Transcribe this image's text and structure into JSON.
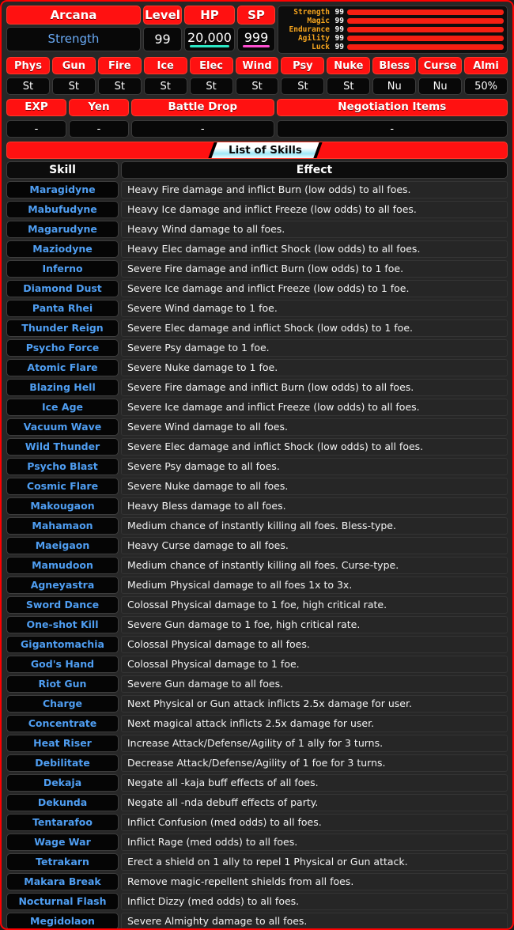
{
  "overview": {
    "arcana_label": "Arcana",
    "arcana_value": "Strength",
    "level_label": "Level",
    "level_value": "99",
    "hp_label": "HP",
    "hp_value": "20,000",
    "sp_label": "SP",
    "sp_value": "999"
  },
  "stats": {
    "max": 99,
    "rows": [
      {
        "name": "Strength",
        "value": "99"
      },
      {
        "name": "Magic",
        "value": "99"
      },
      {
        "name": "Endurance",
        "value": "99"
      },
      {
        "name": "Agility",
        "value": "99"
      },
      {
        "name": "Luck",
        "value": "99"
      }
    ]
  },
  "affinities": [
    {
      "element": "Phys",
      "value": "St"
    },
    {
      "element": "Gun",
      "value": "St"
    },
    {
      "element": "Fire",
      "value": "St"
    },
    {
      "element": "Ice",
      "value": "St"
    },
    {
      "element": "Elec",
      "value": "St"
    },
    {
      "element": "Wind",
      "value": "St"
    },
    {
      "element": "Psy",
      "value": "St"
    },
    {
      "element": "Nuke",
      "value": "St"
    },
    {
      "element": "Bless",
      "value": "Nu"
    },
    {
      "element": "Curse",
      "value": "Nu"
    },
    {
      "element": "Almi",
      "value": "50%"
    }
  ],
  "drops": [
    {
      "label": "EXP",
      "value": "-"
    },
    {
      "label": "Yen",
      "value": "-"
    },
    {
      "label": "Battle Drop",
      "value": "-"
    },
    {
      "label": "Negotiation Items",
      "value": "-"
    }
  ],
  "skills_section": {
    "banner_title": "List of Skills",
    "col_skill": "Skill",
    "col_effect": "Effect"
  },
  "skills": [
    {
      "name": "Maragidyne",
      "effect": "Heavy Fire damage and inflict Burn (low odds) to all foes."
    },
    {
      "name": "Mabufudyne",
      "effect": "Heavy Ice damage and inflict Freeze (low odds) to all foes."
    },
    {
      "name": "Magarudyne",
      "effect": "Heavy Wind damage to all foes."
    },
    {
      "name": "Maziodyne",
      "effect": "Heavy Elec damage and inflict Shock (low odds) to all foes."
    },
    {
      "name": "Inferno",
      "effect": "Severe Fire damage and inflict Burn (low odds) to 1 foe."
    },
    {
      "name": "Diamond Dust",
      "effect": "Severe Ice damage and inflict Freeze (low odds) to 1 foe."
    },
    {
      "name": "Panta Rhei",
      "effect": "Severe Wind damage to 1 foe."
    },
    {
      "name": "Thunder Reign",
      "effect": "Severe Elec damage and inflict Shock (low odds) to 1 foe."
    },
    {
      "name": "Psycho Force",
      "effect": "Severe Psy damage to 1 foe."
    },
    {
      "name": "Atomic Flare",
      "effect": "Severe Nuke damage to 1 foe."
    },
    {
      "name": "Blazing Hell",
      "effect": "Severe Fire damage and inflict Burn (low odds) to all foes."
    },
    {
      "name": "Ice Age",
      "effect": "Severe Ice damage and inflict Freeze (low odds) to all foes."
    },
    {
      "name": "Vacuum Wave",
      "effect": "Severe Wind damage to all foes."
    },
    {
      "name": "Wild Thunder",
      "effect": "Severe Elec damage and inflict Shock (low odds) to all foes."
    },
    {
      "name": "Psycho Blast",
      "effect": "Severe Psy damage to all foes."
    },
    {
      "name": "Cosmic Flare",
      "effect": "Severe Nuke damage to all foes."
    },
    {
      "name": "Makougaon",
      "effect": "Heavy Bless damage to all foes."
    },
    {
      "name": "Mahamaon",
      "effect": "Medium chance of instantly killing all foes. Bless-type."
    },
    {
      "name": "Maeigaon",
      "effect": "Heavy Curse damage to all foes."
    },
    {
      "name": "Mamudoon",
      "effect": "Medium chance of instantly killing all foes. Curse-type."
    },
    {
      "name": "Agneyastra",
      "effect": "Medium Physical damage to all foes 1x to 3x."
    },
    {
      "name": "Sword Dance",
      "effect": "Colossal Physical damage to 1 foe, high critical rate."
    },
    {
      "name": "One-shot Kill",
      "effect": "Severe Gun damage to 1 foe, high critical rate."
    },
    {
      "name": "Gigantomachia",
      "effect": "Colossal Physical damage to all foes."
    },
    {
      "name": "God's Hand",
      "effect": "Colossal Physical damage to 1 foe."
    },
    {
      "name": "Riot Gun",
      "effect": "Severe Gun damage to all foes."
    },
    {
      "name": "Charge",
      "effect": "Next Physical or Gun attack inflicts 2.5x damage for user."
    },
    {
      "name": "Concentrate",
      "effect": "Next magical attack inflicts 2.5x damage for user."
    },
    {
      "name": "Heat Riser",
      "effect": "Increase Attack/Defense/Agility of 1 ally for 3 turns."
    },
    {
      "name": "Debilitate",
      "effect": "Decrease Attack/Defense/Agility of 1 foe for 3 turns."
    },
    {
      "name": "Dekaja",
      "effect": "Negate all -kaja buff effects of all foes."
    },
    {
      "name": "Dekunda",
      "effect": "Negate all -nda debuff effects of party."
    },
    {
      "name": "Tentarafoo",
      "effect": "Inflict Confusion (med odds) to all foes."
    },
    {
      "name": "Wage War",
      "effect": "Inflict Rage (med odds) to all foes."
    },
    {
      "name": "Tetrakarn",
      "effect": "Erect a shield on 1 ally to repel 1 Physical or Gun attack."
    },
    {
      "name": "Makara Break",
      "effect": "Remove magic-repellent shields from all foes."
    },
    {
      "name": "Nocturnal Flash",
      "effect": "Inflict Dizzy (med odds) to all foes."
    },
    {
      "name": "Megidolaon",
      "effect": "Severe Almighty damage to all foes."
    }
  ],
  "colors": {
    "accent_red": "#ff1111",
    "skill_blue": "#4f9ef2",
    "stat_gold": "#f5a41e",
    "hp_underline": "#2ce8c6",
    "sp_underline": "#ff4fd2"
  }
}
